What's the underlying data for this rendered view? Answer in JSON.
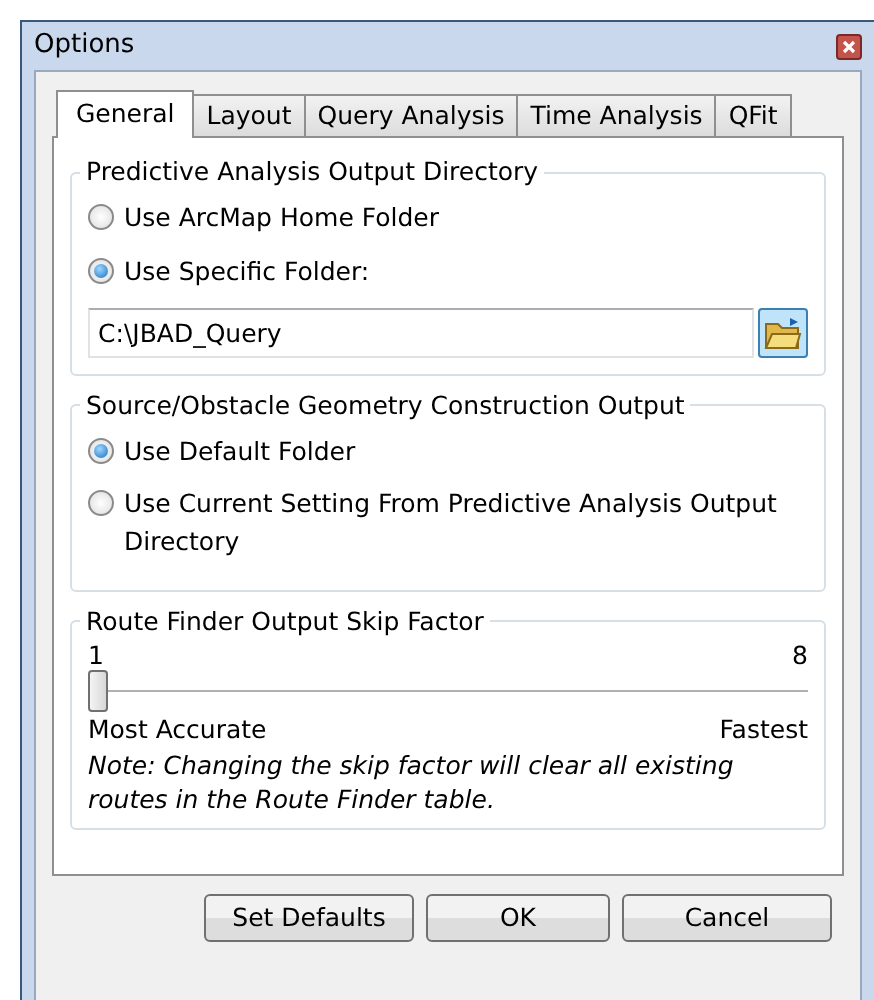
{
  "window": {
    "title": "Options"
  },
  "tabs": [
    {
      "label": "General",
      "selected": true
    },
    {
      "label": "Layout",
      "selected": false
    },
    {
      "label": "Query Analysis",
      "selected": false
    },
    {
      "label": "Time Analysis",
      "selected": false
    },
    {
      "label": "QFit",
      "selected": false
    }
  ],
  "groups": [
    {
      "kind": "radios",
      "title": "Predictive Analysis Output Directory",
      "options": [
        {
          "label": "Use ArcMap Home Folder",
          "selected": false
        },
        {
          "label": "Use Specific Folder:",
          "selected": true
        }
      ],
      "path_field": {
        "value": "C:\\JBAD_Query"
      }
    },
    {
      "kind": "radios",
      "title": "Source/Obstacle Geometry Construction Output",
      "options": [
        {
          "label": "Use Default Folder",
          "selected": true
        },
        {
          "label": "Use Current Setting From Predictive Analysis Output Directory",
          "selected": false
        }
      ]
    },
    {
      "kind": "slider",
      "title": "Route Finder Output Skip Factor",
      "min_label": "1",
      "max_label": "8",
      "level": 0,
      "left_caption": "Most Accurate",
      "right_caption": "Fastest",
      "note": "Note: Changing the skip factor will clear all existing routes in the Route Finder table."
    }
  ],
  "buttons": [
    "Set Defaults",
    "OK",
    "Cancel"
  ]
}
